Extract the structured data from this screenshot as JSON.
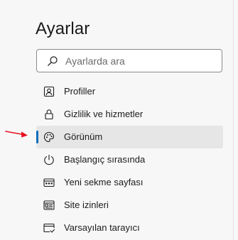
{
  "header": {
    "title": "Ayarlar"
  },
  "search": {
    "placeholder": "Ayarlarda ara",
    "icon": "search-icon"
  },
  "sidebar": {
    "items": [
      {
        "label": "Profiller",
        "icon": "profile-icon",
        "active": false
      },
      {
        "label": "Gizlilik ve hizmetler",
        "icon": "lock-icon",
        "active": false
      },
      {
        "label": "Görünüm",
        "icon": "palette-icon",
        "active": true
      },
      {
        "label": "Başlangıç sırasında",
        "icon": "power-icon",
        "active": false
      },
      {
        "label": "Yeni sekme sayfası",
        "icon": "new-tab-page-icon",
        "active": false
      },
      {
        "label": "Site izinleri",
        "icon": "site-permissions-icon",
        "active": false
      },
      {
        "label": "Varsayılan tarayıcı",
        "icon": "default-browser-icon",
        "active": false
      }
    ]
  },
  "colors": {
    "accent": "#0f6cbd",
    "active_background": "#e6e6e6",
    "page_background": "#f7f7f7",
    "annotation_arrow": "#e81123"
  }
}
